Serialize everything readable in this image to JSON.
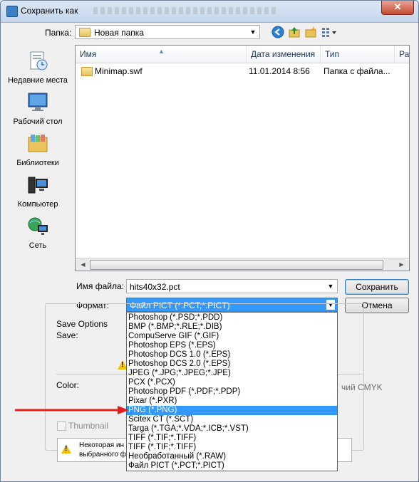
{
  "window": {
    "title": "Сохранить как",
    "close_label": "✕"
  },
  "folder": {
    "label": "Папка:",
    "value": "Новая папка"
  },
  "places": [
    {
      "label": "Недавние места",
      "icon": "recent-places-icon"
    },
    {
      "label": "Рабочий стол",
      "icon": "desktop-icon"
    },
    {
      "label": "Библиотеки",
      "icon": "libraries-icon"
    },
    {
      "label": "Компьютер",
      "icon": "computer-icon"
    },
    {
      "label": "Сеть",
      "icon": "network-icon"
    }
  ],
  "columns": {
    "name": "Имя",
    "date": "Дата изменения",
    "type": "Тип",
    "size": "Раз"
  },
  "files": [
    {
      "name": "Minimap.swf",
      "date": "11.01.2014 8:56",
      "type": "Папка с файла..."
    }
  ],
  "filename": {
    "label": "Имя файла:",
    "value": "hits40x32.pct"
  },
  "format": {
    "label": "Формат:",
    "value": "Файл PICT (*.PCT;*.PICT)"
  },
  "buttons": {
    "save": "Сохранить",
    "cancel": "Отмена"
  },
  "options": {
    "title": "Save Options",
    "save_label": "Save:",
    "color_label": "Color:",
    "cmyk_fragment": "чий CMYK",
    "thumbnail_label": "Thumbnail",
    "warning_line1": "Некоторая ин",
    "warning_line2": "выбранного ф"
  },
  "format_options": [
    "Photoshop (*.PSD;*.PDD)",
    "BMP (*.BMP;*.RLE;*.DIB)",
    "CompuServe GIF (*.GIF)",
    "Photoshop EPS (*.EPS)",
    "Photoshop DCS 1.0 (*.EPS)",
    "Photoshop DCS 2.0 (*.EPS)",
    "JPEG (*.JPG;*.JPEG;*.JPE)",
    "PCX (*.PCX)",
    "Photoshop PDF (*.PDF;*.PDP)",
    "Pixar (*.PXR)",
    "PNG (*.PNG)",
    "Scitex CT (*.SCT)",
    "Targa (*.TGA;*.VDA;*.ICB;*.VST)",
    "TIFF (*.TIF;*.TIFF)",
    "TIFF (*.TIF;*.TIFF)",
    "Необработанный (*.RAW)",
    "Файл PICT (*.PCT;*.PICT)"
  ],
  "selected_format_index": 10,
  "colors": {
    "selection": "#3399ff",
    "annotation_arrow": "#e3201b"
  }
}
